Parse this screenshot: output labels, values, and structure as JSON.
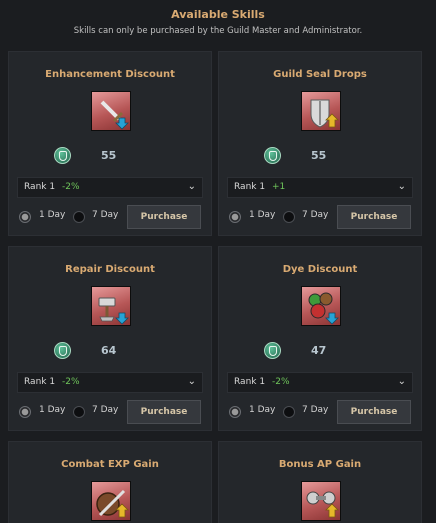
{
  "header": {
    "title": "Available Skills",
    "subtitle": "Skills can only be purchased by the Guild Master and Administrator."
  },
  "common": {
    "one_day": "1 Day",
    "seven_day": "7 Day",
    "purchase": "Purchase"
  },
  "skills": [
    {
      "title": "Enhancement Discount",
      "cost": "55",
      "rank": "Rank 1",
      "bonus": "-2%",
      "icon": "sword-icon",
      "badge": "discount-arrow-icon",
      "duration_selected": "1 Day"
    },
    {
      "title": "Guild Seal Drops",
      "cost": "55",
      "rank": "Rank 1",
      "bonus": "+1",
      "icon": "shield-icon",
      "badge": "up-arrow-icon",
      "duration_selected": "1 Day"
    },
    {
      "title": "Repair Discount",
      "cost": "64",
      "rank": "Rank 1",
      "bonus": "-2%",
      "icon": "hammer-icon",
      "badge": "discount-arrow-icon",
      "duration_selected": "1 Day"
    },
    {
      "title": "Dye Discount",
      "cost": "47",
      "rank": "Rank 1",
      "bonus": "-2%",
      "icon": "dye-pots-icon",
      "badge": "discount-arrow-icon",
      "duration_selected": "1 Day"
    },
    {
      "title": "Combat EXP Gain",
      "icon": "combat-shield-sword-icon",
      "badge": "up-arrow-icon"
    },
    {
      "title": "Bonus AP Gain",
      "icon": "dumbbell-icon",
      "badge": "up-arrow-icon"
    }
  ],
  "colors": {
    "accent_title": "#d9aa72",
    "bonus_green": "#6fc55b",
    "down_arrow": "#27a3d6",
    "up_arrow": "#e6b82a"
  }
}
